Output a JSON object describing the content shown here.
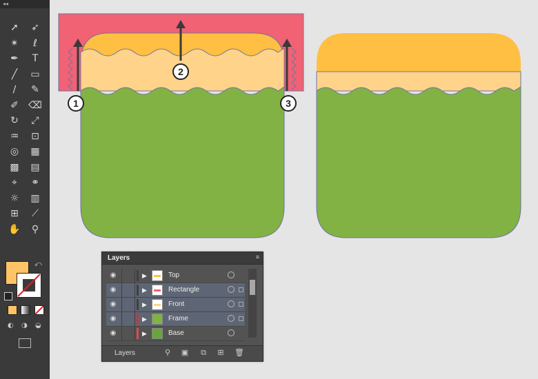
{
  "toolbar": {
    "header_glyph": "◂◂",
    "tools": [
      {
        "name": "selection-tool-icon",
        "glyph": "➚"
      },
      {
        "name": "direct-selection-tool-icon",
        "glyph": "➶"
      },
      {
        "name": "magic-wand-tool-icon",
        "glyph": "✴"
      },
      {
        "name": "lasso-tool-icon",
        "glyph": "ℓ"
      },
      {
        "name": "pen-tool-icon",
        "glyph": "✒"
      },
      {
        "name": "type-tool-icon",
        "glyph": "T"
      },
      {
        "name": "line-tool-icon",
        "glyph": "╱"
      },
      {
        "name": "rectangle-tool-icon",
        "glyph": "▭"
      },
      {
        "name": "paintbrush-tool-icon",
        "glyph": "∕"
      },
      {
        "name": "pencil-tool-icon",
        "glyph": "✎"
      },
      {
        "name": "blob-brush-tool-icon",
        "glyph": "✐"
      },
      {
        "name": "eraser-tool-icon",
        "glyph": "⌫"
      },
      {
        "name": "rotate-tool-icon",
        "glyph": "↻"
      },
      {
        "name": "scale-tool-icon",
        "glyph": "⤢"
      },
      {
        "name": "warp-tool-icon",
        "glyph": "♒"
      },
      {
        "name": "free-transform-tool-icon",
        "glyph": "⊡"
      },
      {
        "name": "shape-builder-tool-icon",
        "glyph": "◎"
      },
      {
        "name": "perspective-grid-tool-icon",
        "glyph": "▦"
      },
      {
        "name": "mesh-tool-icon",
        "glyph": "▩"
      },
      {
        "name": "gradient-tool-icon",
        "glyph": "▤"
      },
      {
        "name": "eyedropper-tool-icon",
        "glyph": "⌖"
      },
      {
        "name": "blend-tool-icon",
        "glyph": "⚭"
      },
      {
        "name": "symbol-sprayer-tool-icon",
        "glyph": "☼"
      },
      {
        "name": "column-graph-tool-icon",
        "glyph": "▥"
      },
      {
        "name": "artboard-tool-icon",
        "glyph": "⊞"
      },
      {
        "name": "slice-tool-icon",
        "glyph": "⟋"
      },
      {
        "name": "hand-tool-icon",
        "glyph": "✋"
      },
      {
        "name": "zoom-tool-icon",
        "glyph": "⚲"
      }
    ],
    "fill_color": "#ffc466",
    "stroke_color": "#ffffff"
  },
  "canvas": {
    "callouts": [
      "1",
      "2",
      "3"
    ],
    "colors": {
      "rectangle": "#f06274",
      "top": "#ffbf42",
      "front": "#ffd38a",
      "frame": "#82b244",
      "path": "#6d74a3"
    }
  },
  "layers_panel": {
    "title": "Layers",
    "menu_glyph": "≡",
    "footer_label": "Layers",
    "layers": [
      {
        "name": "Top",
        "bar_color": "#3f3f3f",
        "thumb": "top-thumb",
        "selected": false
      },
      {
        "name": "Rectangle",
        "bar_color": "#3f3f3f",
        "thumb": "rectangle-thumb",
        "selected": true
      },
      {
        "name": "Front",
        "bar_color": "#3f3f3f",
        "thumb": "front-thumb",
        "selected": true
      },
      {
        "name": "Frame",
        "bar_color": "#c2383a",
        "thumb": "frame-thumb",
        "selected": true
      },
      {
        "name": "Base",
        "bar_color": "#e0484f",
        "thumb": "base-thumb",
        "selected": false
      }
    ],
    "footer_icons": [
      "search-icon",
      "clipping-mask-icon",
      "new-sublayer-icon",
      "new-layer-icon",
      "delete-icon"
    ]
  }
}
